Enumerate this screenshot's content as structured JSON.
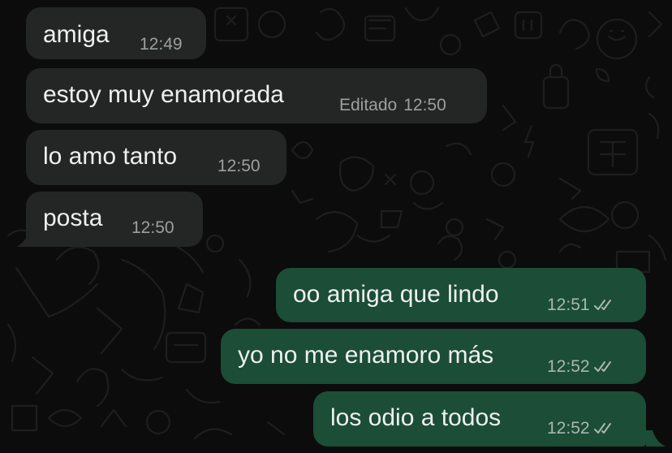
{
  "conversation": {
    "incoming": [
      {
        "text": "amiga",
        "time": "12:49",
        "edited": ""
      },
      {
        "text": "estoy muy enamorada",
        "time": "12:50",
        "edited": "Editado"
      },
      {
        "text": "lo amo tanto",
        "time": "12:50",
        "edited": ""
      },
      {
        "text": "posta",
        "time": "12:50",
        "edited": ""
      }
    ],
    "outgoing": [
      {
        "text": "oo amiga que lindo",
        "time": "12:51",
        "status": "read-double-check-icon"
      },
      {
        "text": "yo no me enamoro más",
        "time": "12:52",
        "status": "read-double-check-icon"
      },
      {
        "text": "los odio a todos",
        "time": "12:52",
        "status": "read-double-check-icon"
      }
    ]
  },
  "colors": {
    "background": "#0c0c0c",
    "incoming_bubble": "#242626",
    "outgoing_bubble": "#1b4d37",
    "message_text": "#eef0ef",
    "meta_text": "#9aa09d"
  }
}
